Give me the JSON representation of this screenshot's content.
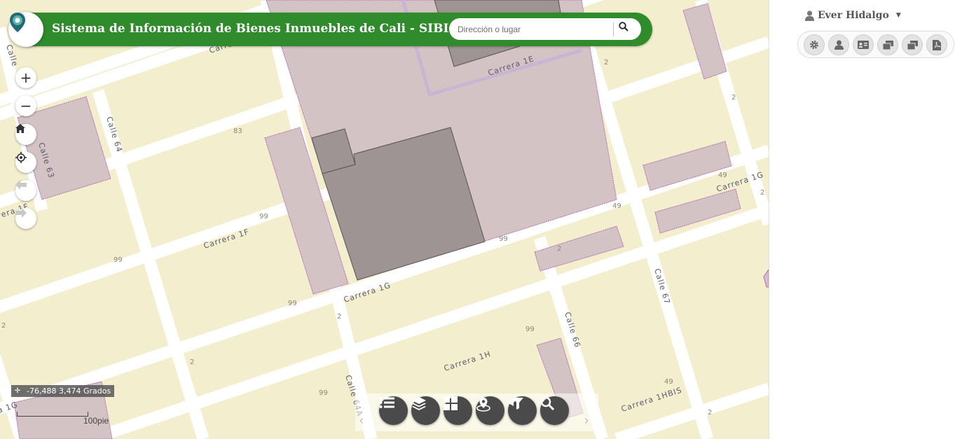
{
  "app": {
    "title": "Sistema de Información de Bienes Inmuebles de Cali - SIBICA"
  },
  "search": {
    "placeholder": "Dirección o lugar",
    "value": ""
  },
  "user": {
    "name": "Ever Hidalgo"
  },
  "coordinates": {
    "text": "-76,488 3,474 Grados"
  },
  "scale": {
    "label": "100pie"
  },
  "map": {
    "street_labels": [
      "Carrera 1E",
      "Calle 64",
      "Calle 63",
      "Carrera 1F",
      "Carrera 1G",
      "Carrera 1H",
      "Carrera 1HBIS",
      "Calle 66",
      "Calle 67",
      "Calle 64A",
      "Carrera 1",
      "Calle",
      "rera 1F",
      "a 1G",
      "Carrera 1G"
    ],
    "block_numbers": [
      "83",
      "99",
      "99",
      "99",
      "99",
      "99",
      "99",
      "49",
      "49",
      "49",
      "2",
      "2",
      "2",
      "2",
      "2",
      "2",
      "2",
      "2"
    ]
  },
  "panel_tools": [
    "gear-icon",
    "user-icon",
    "id-card-icon",
    "windows-icon",
    "windows-alt-icon",
    "pdf-icon"
  ],
  "toolbar_tools": [
    "list-icon",
    "layers-icon",
    "grid-icon",
    "location-pin-icon",
    "filter-layer-icon",
    "search-icon"
  ],
  "colors": {
    "header_bg": "#2f8b2c",
    "map_bg": "#f3efce",
    "parcel_fill": "#d4c3c4",
    "parcel_border": "#b06bb3",
    "building_fill": "#9e9494"
  }
}
